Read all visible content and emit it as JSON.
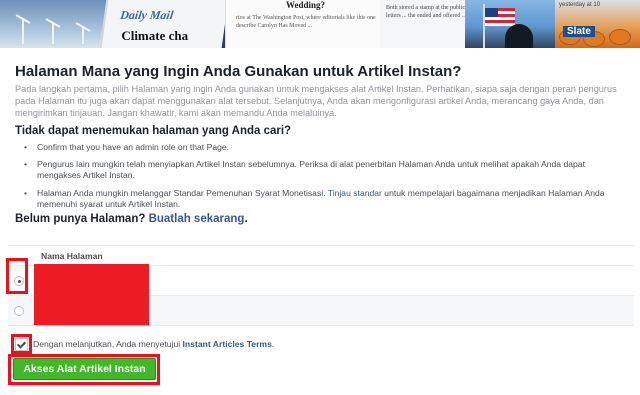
{
  "banner": {
    "dailymail_label": "Daily Mail",
    "climate_headline": "Climate cha",
    "wedding_text": "Wedding?",
    "article_snippet": "rios at The Washington Post, where editorials like this one describe Carolyn Has Moved ...",
    "article_snippet_2": "Both stored a stamp at the public letters ... the ended and offered ...",
    "yesterday_text": "yesterday at 10",
    "slate_label": "Slate"
  },
  "page": {
    "title": "Halaman Mana yang Ingin Anda Gunakan untuk Artikel Instan?",
    "intro": "Pada langkah pertama, pilih Halaman yang ingin Anda gunakan untuk mengakses alat Artikel Instan. Perhatikan, siapa saja dengan peran pengurus pada Halaman itu juga akan dapat menggunakan alat tersebut. Selanjutnya, Anda akan mengonfigurasi artikel Anda, merancang gaya Anda, dan mengirimkan tinjauan. Jangan khawatir, kami akan memandu Anda melaluinya.",
    "subheading": "Tidak dapat menemukan halaman yang Anda cari?",
    "bullets": {
      "b1": "Confirm that you have an admin role on that Page.",
      "b2": "Pengurus lain mungkin telah menyiapkan Artikel Instan sebelumnya. Periksa di alat penerbitan Halaman Anda untuk melihat apakah Anda dapat mengakses Artikel Instan.",
      "b3_pre": "Halaman Anda mungkin melanggar Standar Pemenuhan Syarat Monetisasi. ",
      "b3_link": "Tinjau standar",
      "b3_post": " untuk mempelajari bagaimana menjadikan Halaman Anda memenuhi syarat untuk Artikel Instan."
    },
    "no_page_text": "Belum punya Halaman? ",
    "create_link": "Buatlah sekarang",
    "no_page_end": "."
  },
  "table": {
    "header": "Nama Halaman"
  },
  "agreement": {
    "pre": "Dengan melanjutkan, Anda menyetujui ",
    "link": "Instant Articles Terms",
    "end": ".",
    "checked": true
  },
  "button": {
    "label": "Akses Alat Artikel Instan"
  },
  "colors": {
    "accent_green": "#42b72a",
    "link_blue": "#365899",
    "highlight_red": "#e8111c",
    "redaction_red": "#ed1c24"
  }
}
